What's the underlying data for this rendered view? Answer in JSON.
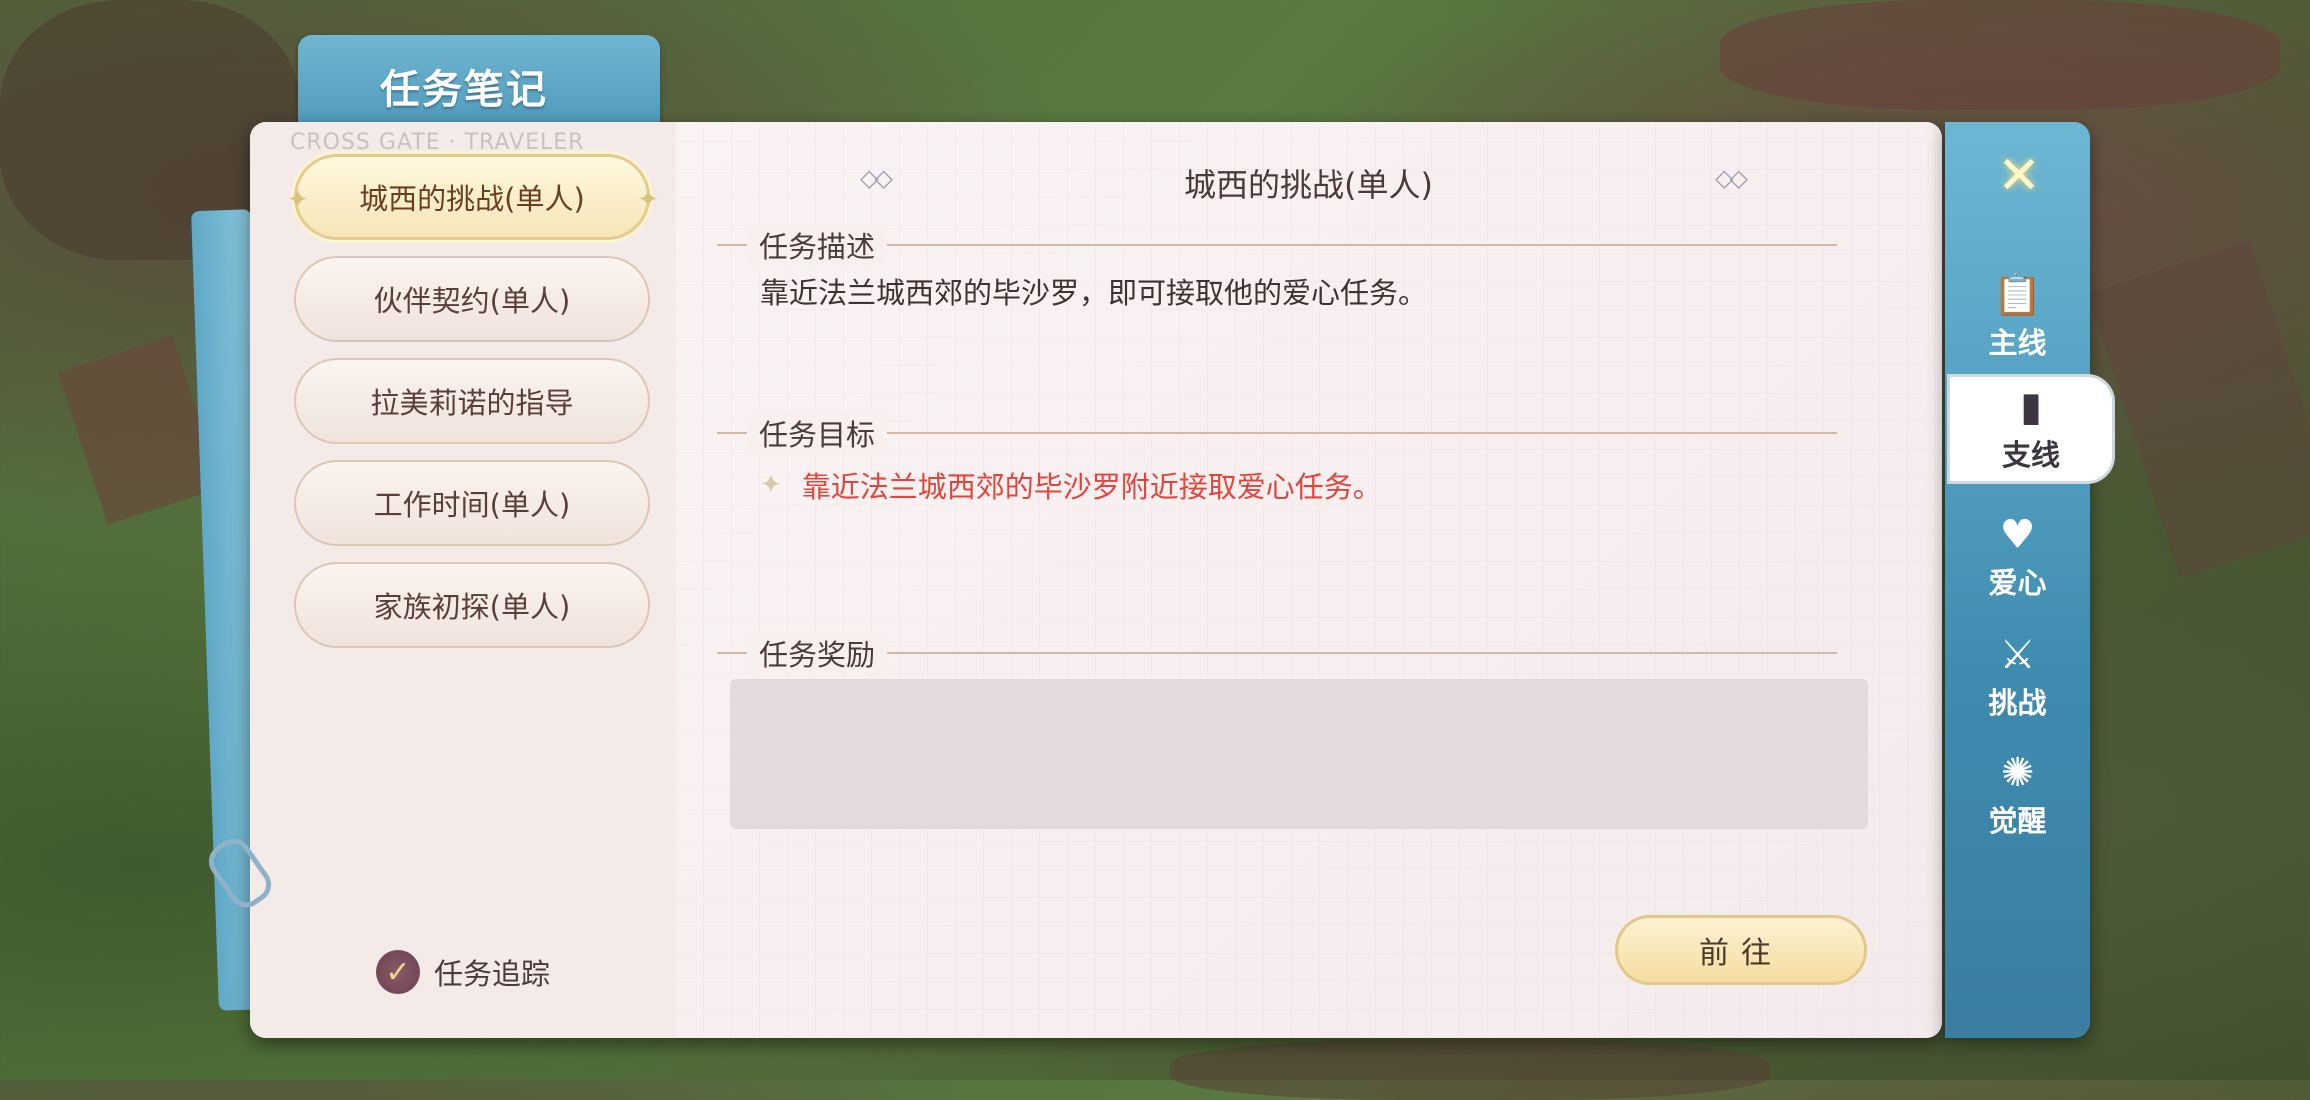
{
  "header": {
    "title": "任务笔记",
    "watermark": "CROSS GATE · TRAVELER"
  },
  "quests": [
    {
      "label": "城西的挑战(单人)",
      "active": true
    },
    {
      "label": "伙伴契约(单人)",
      "active": false
    },
    {
      "label": "拉美莉诺的指导",
      "active": false
    },
    {
      "label": "工作时间(单人)",
      "active": false
    },
    {
      "label": "家族初探(单人)",
      "active": false
    }
  ],
  "tracking": {
    "label": "任务追踪",
    "checked": true
  },
  "detail": {
    "title": "城西的挑战(单人)",
    "description_heading": "任务描述",
    "description": "靠近法兰城西郊的毕沙罗，即可接取他的爱心任务。",
    "goal_heading": "任务目标",
    "goal": "靠近法兰城西郊的毕沙罗附近接取爱心任务。",
    "reward_heading": "任务奖励",
    "go_button": "前往"
  },
  "sidebar": {
    "tabs": [
      {
        "label": "主线",
        "icon": "clipboard-icon"
      },
      {
        "label": "支线",
        "icon": "book-icon",
        "active": true
      },
      {
        "label": "爱心",
        "icon": "heart-icon"
      },
      {
        "label": "挑战",
        "icon": "crossed-swords-icon"
      },
      {
        "label": "觉醒",
        "icon": "awaken-icon"
      }
    ]
  },
  "colors": {
    "goal_text": "#e0463c",
    "accent_blue": "#4f98b8",
    "gold": "#e6cc8c"
  }
}
